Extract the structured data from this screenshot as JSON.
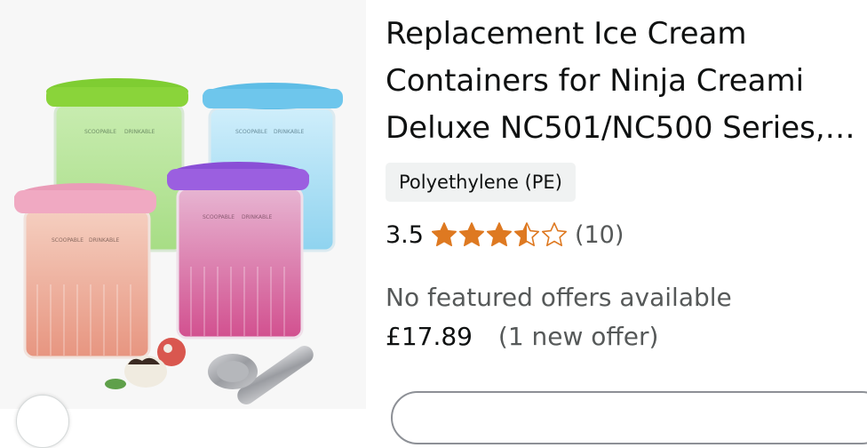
{
  "product": {
    "title_lines": [
      "Replacement Ice Cream",
      "Containers for Ninja Creami",
      "Deluxe NC501/NC500 Series,…"
    ],
    "material": "Polyethylene (PE)",
    "rating": "3.5",
    "rating_fraction": 0.7,
    "review_count": "(10)",
    "no_offers_text": "No featured offers available",
    "price": "£17.89",
    "offer_text": "(1 new offer)"
  },
  "colors": {
    "star": "#de7921",
    "lid_green": "#8ad43a",
    "lid_blue": "#6ec6ec",
    "lid_purple": "#9b5fe0",
    "lid_pink": "#f0a9c2"
  },
  "image": {
    "label_scoopable": "SCOOPABLE",
    "label_drinkable": "DRINKABLE"
  }
}
